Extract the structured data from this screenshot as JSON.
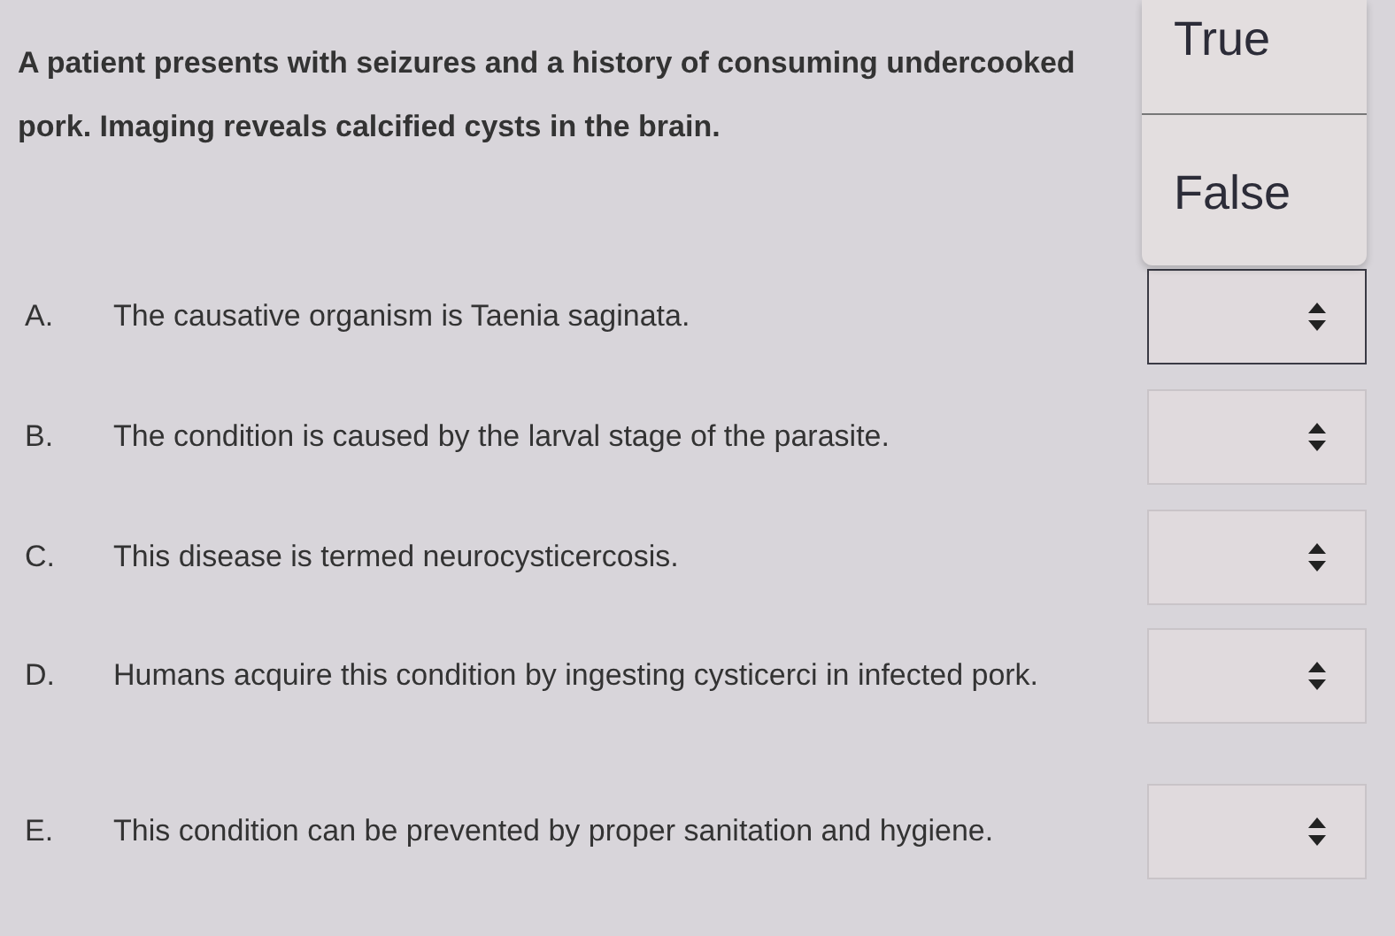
{
  "question": "A patient presents with seizures and a history of consuming undercooked pork. Imaging reveals calcified cysts in the brain.",
  "statements": [
    {
      "letter": "A.",
      "text": "The causative organism is Taenia saginata.",
      "focused": true
    },
    {
      "letter": "B.",
      "text": "The condition is caused by the larval stage of the parasite.",
      "focused": false
    },
    {
      "letter": "C.",
      "text": "This disease is termed neurocysticercosis.",
      "focused": false
    },
    {
      "letter": "D.",
      "text": "Humans acquire this condition by ingesting cysticerci in infected pork.",
      "focused": false
    },
    {
      "letter": "E.",
      "text": "This condition can be prevented by proper sanitation and hygiene.",
      "focused": false
    }
  ],
  "dropdown_menu": {
    "options": [
      "True",
      "False"
    ]
  }
}
